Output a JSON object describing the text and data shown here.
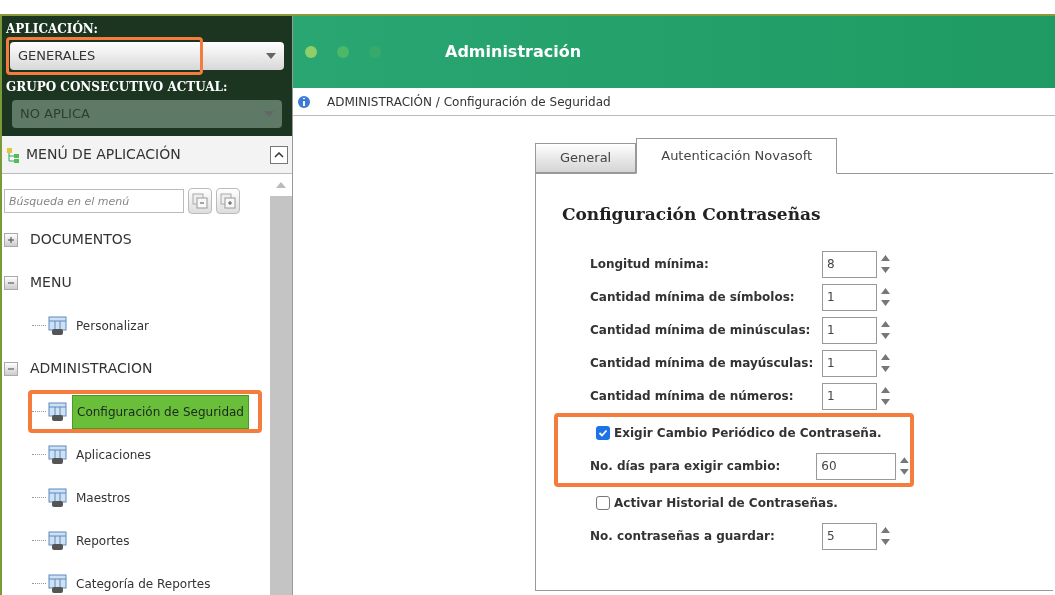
{
  "sidebar": {
    "application_label": "APLICACIÓN:",
    "application_select": {
      "value": "GENERALES",
      "disabled": false,
      "highlighted": true
    },
    "group_label": "GRUPO CONSECUTIVO ACTUAL:",
    "group_select": {
      "value": "NO APLICA",
      "disabled": true
    },
    "menu_title": "MENÚ DE APLICACIÓN",
    "search": {
      "placeholder": "Búsqueda en el menú"
    },
    "tree": [
      {
        "label": "DOCUMENTOS",
        "expanded": false
      },
      {
        "label": "MENU",
        "expanded": true,
        "children": [
          {
            "label": "Personalizar",
            "selected": false,
            "highlighted": false
          }
        ]
      },
      {
        "label": "ADMINISTRACION",
        "expanded": true,
        "children": [
          {
            "label": "Configuración de Seguridad",
            "selected": true,
            "highlighted": true
          },
          {
            "label": "Aplicaciones",
            "selected": false,
            "highlighted": false
          },
          {
            "label": "Maestros",
            "selected": false,
            "highlighted": false
          },
          {
            "label": "Reportes",
            "selected": false,
            "highlighted": false
          },
          {
            "label": "Categoría de Reportes",
            "selected": false,
            "highlighted": false
          }
        ]
      }
    ]
  },
  "header": {
    "title": "Administración"
  },
  "breadcrumb": "ADMINISTRACIÓN / Configuración de Seguridad",
  "tabs": [
    {
      "label": "General",
      "selected": false
    },
    {
      "label": "Autenticación Novasoft",
      "selected": true
    }
  ],
  "section_title": "Configuración Contraseñas",
  "fields": [
    {
      "kind": "number",
      "label": "Longitud mínima:",
      "value": "8"
    },
    {
      "kind": "number",
      "label": "Cantidad mínima de símbolos:",
      "value": "1"
    },
    {
      "kind": "number",
      "label": "Cantidad mínima de minúsculas:",
      "value": "1"
    },
    {
      "kind": "number",
      "label": "Cantidad mínima de mayúsculas:",
      "value": "1"
    },
    {
      "kind": "number",
      "label": "Cantidad mínima de números:",
      "value": "1"
    },
    {
      "kind": "group",
      "highlighted": true,
      "fields": [
        {
          "kind": "checkbox",
          "label": "Exigir Cambio Periódico de Contraseña.",
          "checked": true
        },
        {
          "kind": "number",
          "label": "No. días para exigir cambio:",
          "value": "60",
          "wide": true
        }
      ]
    },
    {
      "kind": "checkbox",
      "label": "Activar Historial de Contraseñas.",
      "checked": false
    },
    {
      "kind": "number",
      "label": "No. contraseñas a guardar:",
      "value": "5"
    }
  ]
}
